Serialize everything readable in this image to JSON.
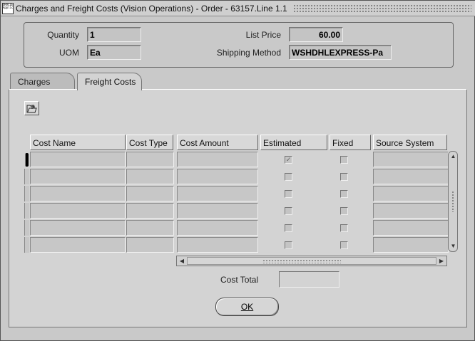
{
  "window": {
    "title": "Charges and Freight Costs (Vision Operations) - Order - 63157.Line 1.1",
    "icon_text": "ORACLE Applications"
  },
  "header": {
    "quantity_label": "Quantity",
    "quantity_value": "1",
    "uom_label": "UOM",
    "uom_value": "Ea",
    "list_price_label": "List Price",
    "list_price_value": "60.00",
    "shipping_method_label": "Shipping Method",
    "shipping_method_value": "WSHDHLEXPRESS-Pa"
  },
  "tabs": [
    {
      "label": "Charges",
      "active": false
    },
    {
      "label": "Freight Costs",
      "active": true
    }
  ],
  "table": {
    "columns": [
      "Cost Name",
      "Cost Type",
      "Cost Amount",
      "Estimated",
      "Fixed",
      "Source System"
    ],
    "rows": [
      {
        "cost_name": "",
        "cost_type": "",
        "cost_amount": "",
        "estimated": true,
        "fixed": false,
        "source_system": ""
      },
      {
        "cost_name": "",
        "cost_type": "",
        "cost_amount": "",
        "estimated": false,
        "fixed": false,
        "source_system": ""
      },
      {
        "cost_name": "",
        "cost_type": "",
        "cost_amount": "",
        "estimated": false,
        "fixed": false,
        "source_system": ""
      },
      {
        "cost_name": "",
        "cost_type": "",
        "cost_amount": "",
        "estimated": false,
        "fixed": false,
        "source_system": ""
      },
      {
        "cost_name": "",
        "cost_type": "",
        "cost_amount": "",
        "estimated": false,
        "fixed": false,
        "source_system": ""
      },
      {
        "cost_name": "",
        "cost_type": "",
        "cost_amount": "",
        "estimated": false,
        "fixed": false,
        "source_system": ""
      }
    ],
    "current_row": 0
  },
  "footer": {
    "cost_total_label": "Cost Total",
    "cost_total_value": "",
    "ok_label": "OK"
  },
  "icons": {
    "attachment": "folder-paperclip-icon",
    "scroll_up": "▲",
    "scroll_down": "▼",
    "scroll_left": "◀",
    "scroll_right": "▶"
  }
}
